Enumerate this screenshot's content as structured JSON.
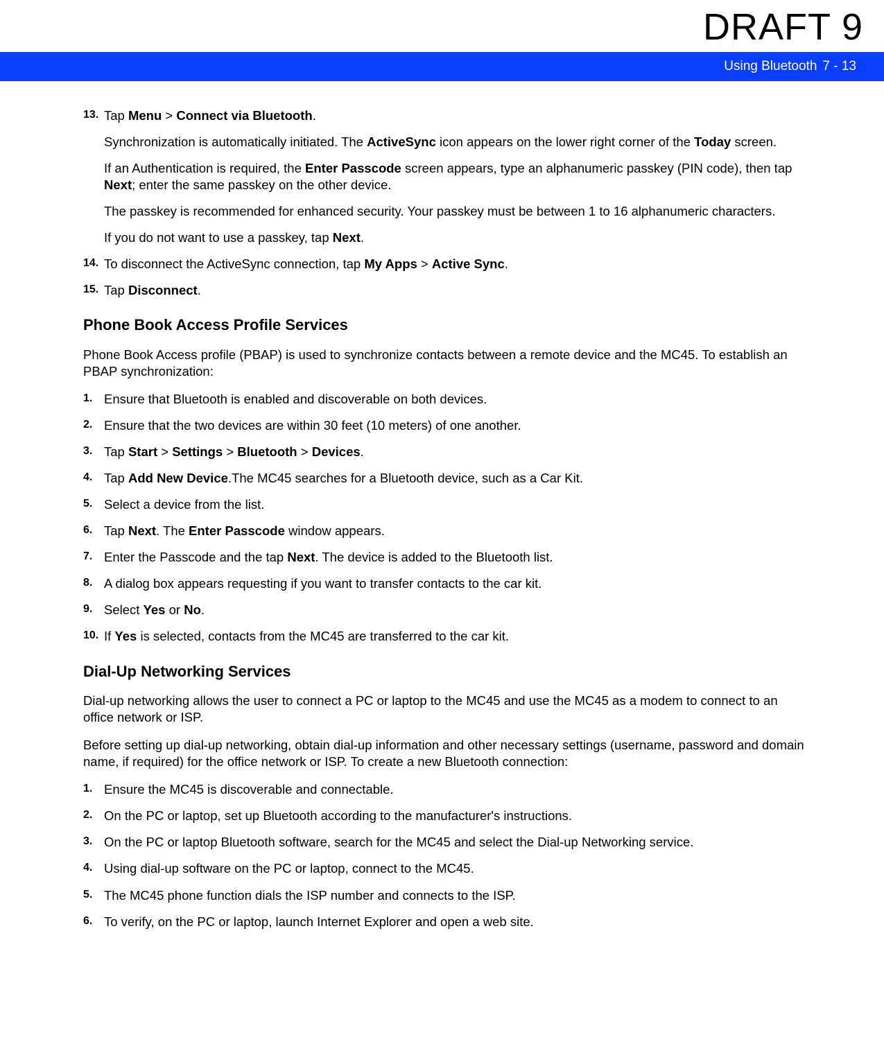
{
  "watermark": "DRAFT 9",
  "header": {
    "title": "Using Bluetooth",
    "pagenum": "7 - 13"
  },
  "section1": {
    "step13": {
      "num": "13.",
      "line1a": "Tap ",
      "line1b": "Menu",
      "line1c": " > ",
      "line1d": "Connect via Bluetooth",
      "line1e": ".",
      "p2a": "Synchronization is automatically initiated. The ",
      "p2b": "ActiveSync",
      "p2c": " icon appears on the lower right corner of the ",
      "p2d": "Today",
      "p2e": " screen.",
      "p3a": "If an Authentication is required, the ",
      "p3b": "Enter Passcode",
      "p3c": " screen appears, type an alphanumeric passkey (PIN code), then tap ",
      "p3d": "Next",
      "p3e": "; enter the same passkey on the other device.",
      "p4": "The passkey is recommended for enhanced security. Your passkey must be between 1 to 16 alphanumeric characters.",
      "p5a": "If you do not want to use a passkey, tap ",
      "p5b": "Next",
      "p5c": "."
    },
    "step14": {
      "num": "14.",
      "a": "To disconnect the ActiveSync connection, tap ",
      "b": "My Apps",
      "c": " > ",
      "d": "Active Sync",
      "e": "."
    },
    "step15": {
      "num": "15.",
      "a": "Tap ",
      "b": "Disconnect",
      "c": "."
    }
  },
  "section2": {
    "heading": "Phone Book Access Profile Services",
    "intro": "Phone Book Access profile (PBAP) is used to synchronize contacts between a remote device and the MC45. To establish an PBAP synchronization:",
    "steps": {
      "s1": {
        "num": "1.",
        "text": "Ensure that Bluetooth is enabled and discoverable on both devices."
      },
      "s2": {
        "num": "2.",
        "text": "Ensure that the two devices are within 30 feet (10 meters) of one another."
      },
      "s3": {
        "num": "3.",
        "a": "Tap ",
        "b": "Start",
        "c": " > ",
        "d": "Settings",
        "e": " > ",
        "f": "Bluetooth",
        "g": " > ",
        "h": "Devices",
        "i": "."
      },
      "s4": {
        "num": "4.",
        "a": "Tap ",
        "b": "Add New Device",
        "c": ".The MC45 searches for a Bluetooth device, such as a Car Kit."
      },
      "s5": {
        "num": "5.",
        "text": "Select a device from the list."
      },
      "s6": {
        "num": "6.",
        "a": "Tap ",
        "b": "Next",
        "c": ". The ",
        "d": "Enter Passcode",
        "e": " window appears."
      },
      "s7": {
        "num": "7.",
        "a": "Enter the Passcode and the tap ",
        "b": "Next",
        "c": ". The device is added to the Bluetooth list."
      },
      "s8": {
        "num": "8.",
        "text": "A dialog box appears requesting if you want to transfer contacts to the car kit."
      },
      "s9": {
        "num": "9.",
        "a": "Select ",
        "b": "Yes",
        "c": " or ",
        "d": "No",
        "e": "."
      },
      "s10": {
        "num": "10.",
        "a": "If ",
        "b": "Yes",
        "c": " is selected, contacts from the MC45 are transferred to the car kit."
      }
    }
  },
  "section3": {
    "heading": "Dial-Up Networking Services",
    "intro1": "Dial-up networking allows the user to connect a PC or laptop to the MC45 and use the MC45 as a modem to connect to an office network or ISP.",
    "intro2": "Before setting up dial-up networking, obtain dial-up information and other necessary settings (username, password and domain name, if required) for the office network or ISP. To create a new Bluetooth connection:",
    "steps": {
      "s1": {
        "num": "1.",
        "text": "Ensure the MC45 is discoverable and connectable."
      },
      "s2": {
        "num": "2.",
        "text": "On the PC or laptop, set up Bluetooth according to the manufacturer's instructions."
      },
      "s3": {
        "num": "3.",
        "text": "On the PC or laptop Bluetooth software, search for the MC45 and select the Dial-up Networking service."
      },
      "s4": {
        "num": "4.",
        "text": "Using dial-up software on the PC or laptop, connect to the MC45."
      },
      "s5": {
        "num": "5.",
        "text": "The MC45 phone function dials the ISP number and connects to the ISP."
      },
      "s6": {
        "num": "6.",
        "text": "To verify, on the PC or laptop, launch Internet Explorer and open a web site."
      }
    }
  }
}
